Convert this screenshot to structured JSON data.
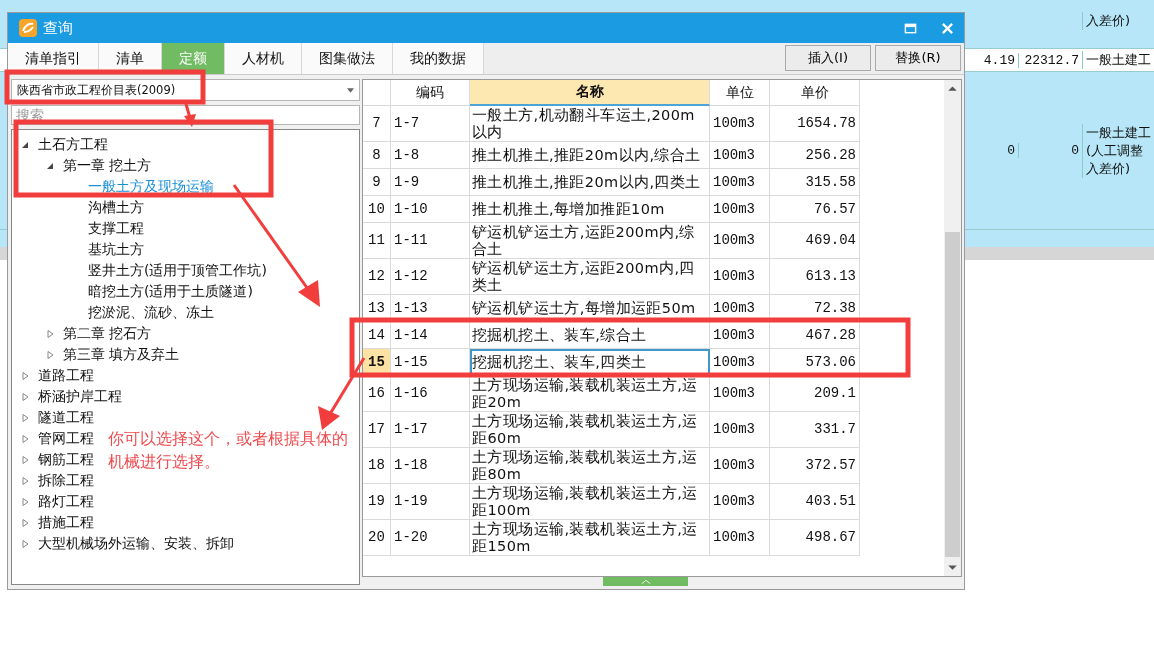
{
  "background_sheet": {
    "right_rows": [
      {
        "col_3": [
          "入差价)"
        ]
      },
      {
        "col_1": "4.19",
        "col_2": "22312.7",
        "col_3": [
          "一般土建工"
        ]
      },
      {
        "col_1": "0",
        "col_2": "0",
        "col_3": [
          "一般土建工",
          "(人工调整",
          "入差价)"
        ]
      }
    ]
  },
  "window": {
    "title": "查询"
  },
  "tabs": [
    {
      "label": "清单指引",
      "selected": false
    },
    {
      "label": "清单",
      "selected": false
    },
    {
      "label": "定额",
      "selected": true
    },
    {
      "label": "人材机",
      "selected": false
    },
    {
      "label": "图集做法",
      "selected": false
    },
    {
      "label": "我的数据",
      "selected": false
    }
  ],
  "buttons": [
    "插入(I)",
    "替换(R)"
  ],
  "library_select": {
    "value": "陕西省市政工程价目表(2009)"
  },
  "search": {
    "placeholder": "搜索"
  },
  "tree": [
    {
      "label": "土石方工程",
      "expanded": true,
      "selected": false,
      "children": [
        {
          "label": "第一章  挖土方",
          "expanded": true,
          "selected": false,
          "children": [
            {
              "label": "一般土方及现场运输",
              "selected": true
            },
            {
              "label": "沟槽土方",
              "selected": false
            },
            {
              "label": "支撑工程",
              "selected": false
            },
            {
              "label": "基坑土方",
              "selected": false
            },
            {
              "label": "竖井土方(适用于顶管工作坑)",
              "selected": false
            },
            {
              "label": "暗挖土方(适用于土质隧道)",
              "selected": false
            },
            {
              "label": "挖淤泥、流砂、冻土",
              "selected": false
            }
          ]
        },
        {
          "label": "第二章  挖石方",
          "expanded": false,
          "selected": false
        },
        {
          "label": "第三章  填方及弃土",
          "expanded": false,
          "selected": false
        }
      ]
    },
    {
      "label": "道路工程",
      "expanded": false,
      "selected": false
    },
    {
      "label": "桥涵护岸工程",
      "expanded": false,
      "selected": false
    },
    {
      "label": "隧道工程",
      "expanded": false,
      "selected": false
    },
    {
      "label": "管网工程",
      "expanded": false,
      "selected": false
    },
    {
      "label": "钢筋工程",
      "expanded": false,
      "selected": false
    },
    {
      "label": "拆除工程",
      "expanded": false,
      "selected": false
    },
    {
      "label": "路灯工程",
      "expanded": false,
      "selected": false
    },
    {
      "label": "措施工程",
      "expanded": false,
      "selected": false
    },
    {
      "label": "大型机械场外运输、安装、拆卸",
      "expanded": false,
      "selected": false
    }
  ],
  "table": {
    "columns": [
      "编码",
      "名称",
      "单位",
      "单价"
    ],
    "rows": [
      {
        "no": "7",
        "code": "1-7",
        "name": "一般土方,机动翻斗车运土,200m以内",
        "unit": "100m3",
        "price": "1654.78",
        "selected": false
      },
      {
        "no": "8",
        "code": "1-8",
        "name": "推土机推土,推距20m以内,综合土",
        "unit": "100m3",
        "price": "256.28",
        "selected": false
      },
      {
        "no": "9",
        "code": "1-9",
        "name": "推土机推土,推距20m以内,四类土",
        "unit": "100m3",
        "price": "315.58",
        "selected": false
      },
      {
        "no": "10",
        "code": "1-10",
        "name": "推土机推土,每增加推距10m",
        "unit": "100m3",
        "price": "76.57",
        "selected": false
      },
      {
        "no": "11",
        "code": "1-11",
        "name": "铲运机铲运土方,运距200m内,综合土",
        "unit": "100m3",
        "price": "469.04",
        "selected": false
      },
      {
        "no": "12",
        "code": "1-12",
        "name": "铲运机铲运土方,运距200m内,四类土",
        "unit": "100m3",
        "price": "613.13",
        "selected": false
      },
      {
        "no": "13",
        "code": "1-13",
        "name": "铲运机铲运土方,每增加运距50m",
        "unit": "100m3",
        "price": "72.38",
        "selected": false
      },
      {
        "no": "14",
        "code": "1-14",
        "name": "挖掘机挖土、装车,综合土",
        "unit": "100m3",
        "price": "467.28",
        "selected": false
      },
      {
        "no": "15",
        "code": "1-15",
        "name": "挖掘机挖土、装车,四类土",
        "unit": "100m3",
        "price": "573.06",
        "selected": true
      },
      {
        "no": "16",
        "code": "1-16",
        "name": "土方现场运输,装载机装运土方,运距20m",
        "unit": "100m3",
        "price": "209.1",
        "selected": false
      },
      {
        "no": "17",
        "code": "1-17",
        "name": "土方现场运输,装载机装运土方,运距60m",
        "unit": "100m3",
        "price": "331.7",
        "selected": false
      },
      {
        "no": "18",
        "code": "1-18",
        "name": "土方现场运输,装载机装运土方,运距80m",
        "unit": "100m3",
        "price": "372.57",
        "selected": false
      },
      {
        "no": "19",
        "code": "1-19",
        "name": "土方现场运输,装载机装运土方,运距100m",
        "unit": "100m3",
        "price": "403.51",
        "selected": false
      },
      {
        "no": "20",
        "code": "1-20",
        "name": "土方现场运输,装载机装运土方,运距150m",
        "unit": "100m3",
        "price": "498.67",
        "selected": false
      }
    ]
  },
  "annotation": {
    "note": "你可以选择这个，或者根据具体的机械进行选择。"
  }
}
